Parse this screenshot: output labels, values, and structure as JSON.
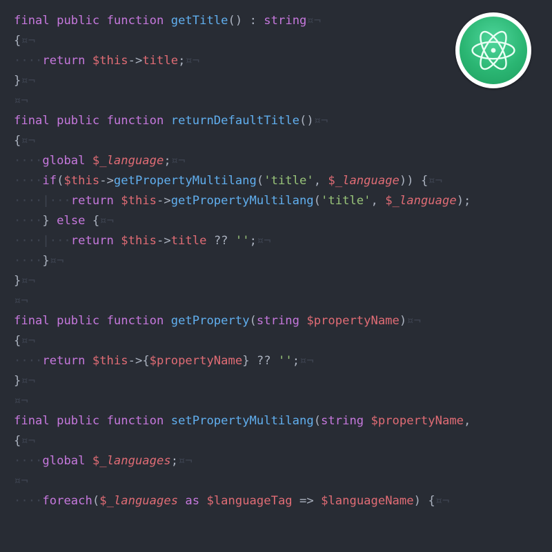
{
  "editor": "Atom",
  "theme": "One Dark",
  "language": "PHP",
  "invisibles": {
    "space": "·",
    "eol": "¤¬",
    "indent_guide": "|"
  },
  "syntax_colors": {
    "keyword": "#c678dd",
    "function": "#61afef",
    "variable": "#e06c75",
    "string": "#98c379",
    "text": "#abb2bf",
    "invisible": "#3e4451",
    "background": "#282c34"
  },
  "logo": {
    "name": "atom-logo-icon",
    "colors": [
      "#4fd69c",
      "#2bb673"
    ]
  },
  "code_tokens": [
    [
      [
        "kw",
        "final"
      ],
      [
        "inv",
        " "
      ],
      [
        "kw",
        "public"
      ],
      [
        "inv",
        " "
      ],
      [
        "kw",
        "function"
      ],
      [
        "inv",
        " "
      ],
      [
        "fn",
        "getTitle"
      ],
      [
        "pun",
        "()"
      ],
      [
        "inv",
        " "
      ],
      [
        "pun",
        ":"
      ],
      [
        "inv",
        " "
      ],
      [
        "type",
        "string"
      ],
      [
        "inv",
        "¤¬"
      ]
    ],
    [
      [
        "brace",
        "{"
      ],
      [
        "inv",
        "¤¬"
      ]
    ],
    [
      [
        "inv",
        "····"
      ],
      [
        "kw",
        "return"
      ],
      [
        "inv",
        " "
      ],
      [
        "var",
        "$this"
      ],
      [
        "arrow",
        "->"
      ],
      [
        "prop",
        "title"
      ],
      [
        "pun",
        ";"
      ],
      [
        "inv",
        "¤¬"
      ]
    ],
    [
      [
        "brace",
        "}"
      ],
      [
        "inv",
        "¤¬"
      ]
    ],
    [
      [
        "inv",
        "¤¬"
      ]
    ],
    [
      [
        "kw",
        "final"
      ],
      [
        "inv",
        " "
      ],
      [
        "kw",
        "public"
      ],
      [
        "inv",
        " "
      ],
      [
        "kw",
        "function"
      ],
      [
        "inv",
        " "
      ],
      [
        "fn",
        "returnDefaultTitle"
      ],
      [
        "pun",
        "()"
      ],
      [
        "inv",
        "¤¬"
      ]
    ],
    [
      [
        "brace",
        "{"
      ],
      [
        "inv",
        "¤¬"
      ]
    ],
    [
      [
        "inv",
        "····"
      ],
      [
        "kw",
        "global"
      ],
      [
        "inv",
        " "
      ],
      [
        "var",
        "$"
      ],
      [
        "varu",
        "_language"
      ],
      [
        "pun",
        ";"
      ],
      [
        "inv",
        "¤¬"
      ]
    ],
    [
      [
        "inv",
        "····"
      ],
      [
        "kw",
        "if"
      ],
      [
        "pun",
        "("
      ],
      [
        "var",
        "$this"
      ],
      [
        "arrow",
        "->"
      ],
      [
        "fn",
        "getPropertyMultilang"
      ],
      [
        "pun",
        "("
      ],
      [
        "str",
        "'title'"
      ],
      [
        "pun",
        ","
      ],
      [
        "inv",
        " "
      ],
      [
        "var",
        "$"
      ],
      [
        "varu",
        "_language"
      ],
      [
        "pun",
        "))"
      ],
      [
        "inv",
        " "
      ],
      [
        "brace",
        "{"
      ],
      [
        "inv",
        "¤¬"
      ]
    ],
    [
      [
        "inv",
        "····|···"
      ],
      [
        "kw",
        "return"
      ],
      [
        "inv",
        " "
      ],
      [
        "var",
        "$this"
      ],
      [
        "arrow",
        "->"
      ],
      [
        "fn",
        "getPropertyMultilang"
      ],
      [
        "pun",
        "("
      ],
      [
        "str",
        "'title'"
      ],
      [
        "pun",
        ","
      ],
      [
        "inv",
        " "
      ],
      [
        "var",
        "$"
      ],
      [
        "varu",
        "_language"
      ],
      [
        "pun",
        ");"
      ]
    ],
    [
      [
        "inv",
        "····"
      ],
      [
        "brace",
        "}"
      ],
      [
        "inv",
        " "
      ],
      [
        "kw",
        "else"
      ],
      [
        "inv",
        " "
      ],
      [
        "brace",
        "{"
      ],
      [
        "inv",
        "¤¬"
      ]
    ],
    [
      [
        "inv",
        "····|···"
      ],
      [
        "kw",
        "return"
      ],
      [
        "inv",
        " "
      ],
      [
        "var",
        "$this"
      ],
      [
        "arrow",
        "->"
      ],
      [
        "prop",
        "title"
      ],
      [
        "inv",
        " "
      ],
      [
        "pun",
        "??"
      ],
      [
        "inv",
        " "
      ],
      [
        "str",
        "''"
      ],
      [
        "pun",
        ";"
      ],
      [
        "inv",
        "¤¬"
      ]
    ],
    [
      [
        "inv",
        "····"
      ],
      [
        "brace",
        "}"
      ],
      [
        "inv",
        "¤¬"
      ]
    ],
    [
      [
        "brace",
        "}"
      ],
      [
        "inv",
        "¤¬"
      ]
    ],
    [
      [
        "inv",
        "¤¬"
      ]
    ],
    [
      [
        "kw",
        "final"
      ],
      [
        "inv",
        " "
      ],
      [
        "kw",
        "public"
      ],
      [
        "inv",
        " "
      ],
      [
        "kw",
        "function"
      ],
      [
        "inv",
        " "
      ],
      [
        "fn",
        "getProperty"
      ],
      [
        "pun",
        "("
      ],
      [
        "type",
        "string"
      ],
      [
        "inv",
        " "
      ],
      [
        "var",
        "$propertyName"
      ],
      [
        "pun",
        ")"
      ],
      [
        "inv",
        "¤¬"
      ]
    ],
    [
      [
        "brace",
        "{"
      ],
      [
        "inv",
        "¤¬"
      ]
    ],
    [
      [
        "inv",
        "····"
      ],
      [
        "kw",
        "return"
      ],
      [
        "inv",
        " "
      ],
      [
        "var",
        "$this"
      ],
      [
        "arrow",
        "->"
      ],
      [
        "pun",
        "{"
      ],
      [
        "var",
        "$propertyName"
      ],
      [
        "pun",
        "}"
      ],
      [
        "inv",
        " "
      ],
      [
        "pun",
        "??"
      ],
      [
        "inv",
        " "
      ],
      [
        "str",
        "''"
      ],
      [
        "pun",
        ";"
      ],
      [
        "inv",
        "¤¬"
      ]
    ],
    [
      [
        "brace",
        "}"
      ],
      [
        "inv",
        "¤¬"
      ]
    ],
    [
      [
        "inv",
        "¤¬"
      ]
    ],
    [
      [
        "kw",
        "final"
      ],
      [
        "inv",
        " "
      ],
      [
        "kw",
        "public"
      ],
      [
        "inv",
        " "
      ],
      [
        "kw",
        "function"
      ],
      [
        "inv",
        " "
      ],
      [
        "fn",
        "setPropertyMultilang"
      ],
      [
        "pun",
        "("
      ],
      [
        "type",
        "string"
      ],
      [
        "inv",
        " "
      ],
      [
        "var",
        "$propertyName"
      ],
      [
        "pun",
        ","
      ]
    ],
    [
      [
        "brace",
        "{"
      ],
      [
        "inv",
        "¤¬"
      ]
    ],
    [
      [
        "inv",
        "····"
      ],
      [
        "kw",
        "global"
      ],
      [
        "inv",
        " "
      ],
      [
        "var",
        "$"
      ],
      [
        "varu",
        "_languages"
      ],
      [
        "pun",
        ";"
      ],
      [
        "inv",
        "¤¬"
      ]
    ],
    [
      [
        "inv",
        "¤¬"
      ]
    ],
    [
      [
        "inv",
        "····"
      ],
      [
        "kw",
        "foreach"
      ],
      [
        "pun",
        "("
      ],
      [
        "var",
        "$"
      ],
      [
        "varu",
        "_languages"
      ],
      [
        "inv",
        " "
      ],
      [
        "kw",
        "as"
      ],
      [
        "inv",
        " "
      ],
      [
        "var",
        "$languageTag"
      ],
      [
        "inv",
        " "
      ],
      [
        "pun",
        "=>"
      ],
      [
        "inv",
        " "
      ],
      [
        "var",
        "$languageName"
      ],
      [
        "pun",
        ")"
      ],
      [
        "inv",
        " "
      ],
      [
        "brace",
        "{"
      ],
      [
        "inv",
        "¤¬"
      ]
    ]
  ]
}
